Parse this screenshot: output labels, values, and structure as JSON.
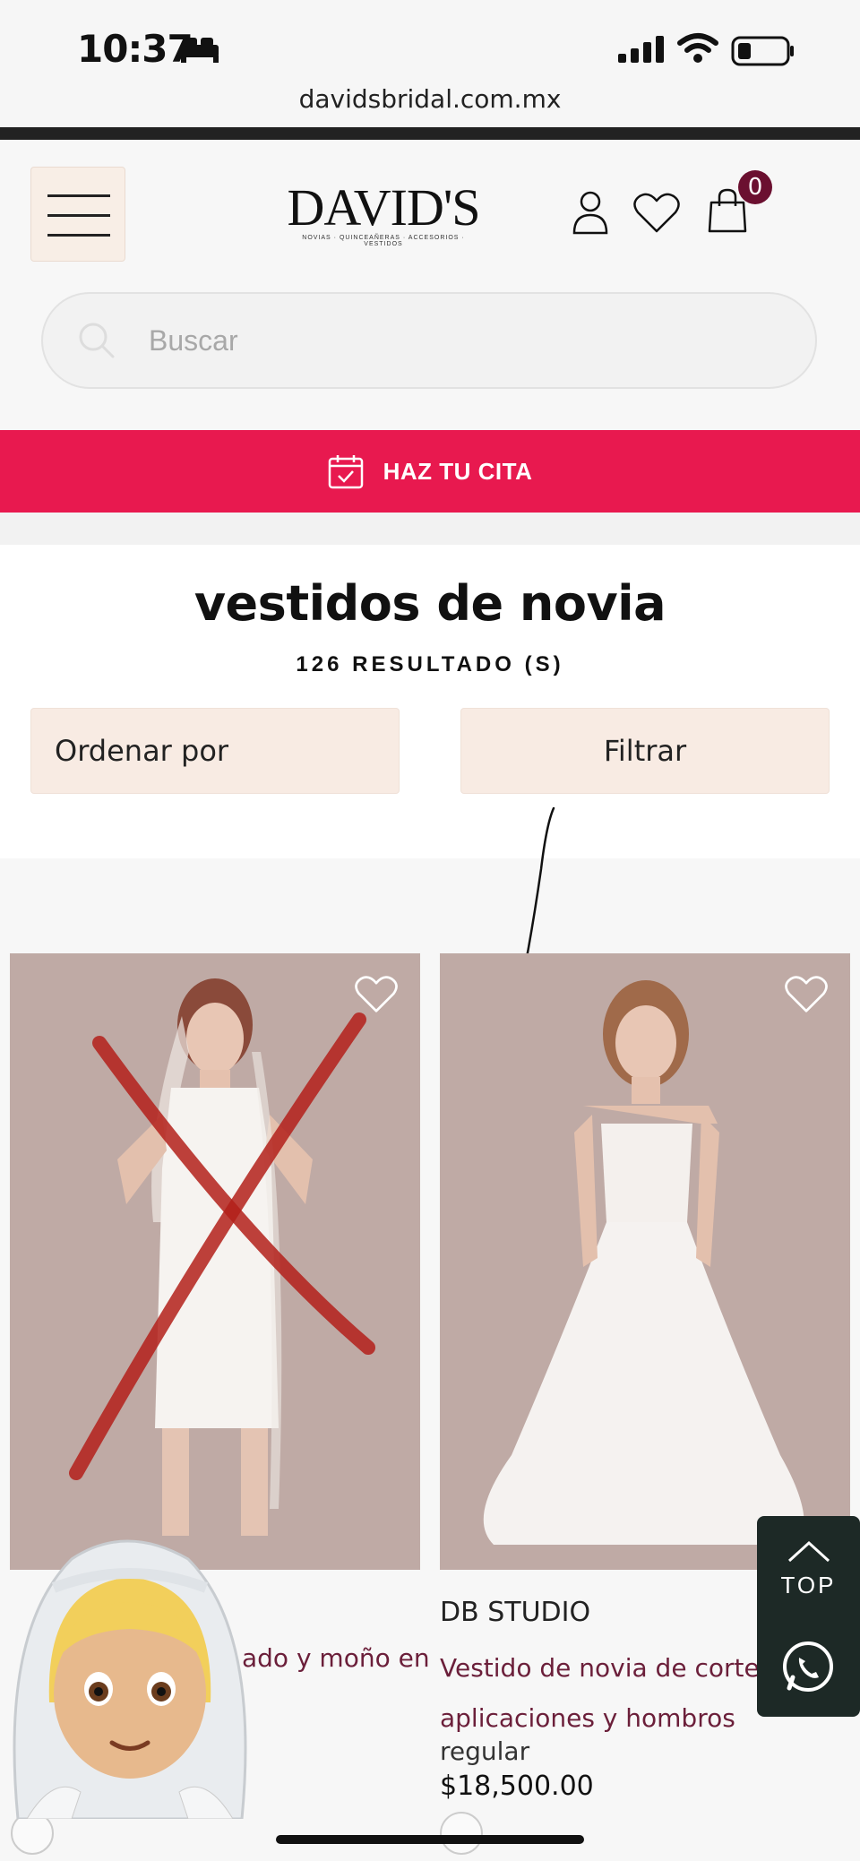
{
  "status_bar": {
    "time": "10:37",
    "url": "davidsbridal.com.mx"
  },
  "header": {
    "logo_text": "DAVID'S",
    "logo_tagline": "NOVIAS · QUINCEAÑERAS · ACCESORIOS · VESTIDOS",
    "cart_count": "0",
    "search_placeholder": "Buscar"
  },
  "cta": {
    "label": "HAZ TU CITA",
    "color": "#e8194f"
  },
  "results": {
    "title": "vestidos de novia",
    "count_label": "126 RESULTADO (S)",
    "sort_label": "Ordenar por",
    "filter_label": "Filtrar"
  },
  "products": [
    {
      "brand": "",
      "name_visible": "ado y moño en"
    },
    {
      "brand": "DB STUDIO",
      "name": "Vestido de novia de corte A c",
      "name_line2": "aplicaciones y hombros",
      "condition": "regular",
      "price": "$18,500.00"
    }
  ],
  "floating": {
    "top_label": "TOP"
  },
  "colors": {
    "accent": "#e8194f",
    "brand_wine": "#6b1030",
    "panel": "#1d2926"
  }
}
